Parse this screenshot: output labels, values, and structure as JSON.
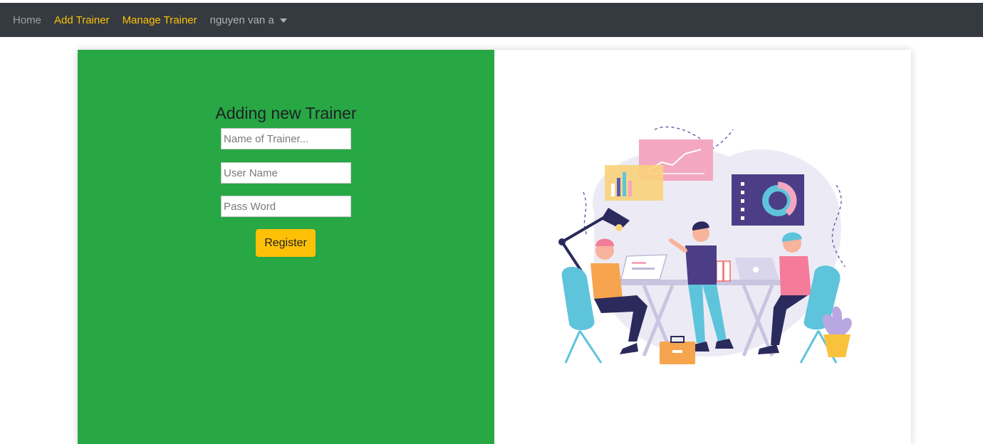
{
  "nav": {
    "home": "Home",
    "add_trainer": "Add Trainer",
    "manage_trainer": "Manage Trainer",
    "user": "nguyen van a"
  },
  "form": {
    "title": "Adding new Trainer",
    "name_placeholder": "Name of Trainer...",
    "username_placeholder": "User Name",
    "password_placeholder": "Pass Word",
    "register_label": "Register"
  },
  "colors": {
    "navbar_bg": "#343a40",
    "nav_active": "#ffc107",
    "panel_green": "#28a745",
    "button_yellow": "#ffc107"
  },
  "illustration": {
    "subject": "team-working-at-desk-illustration"
  }
}
